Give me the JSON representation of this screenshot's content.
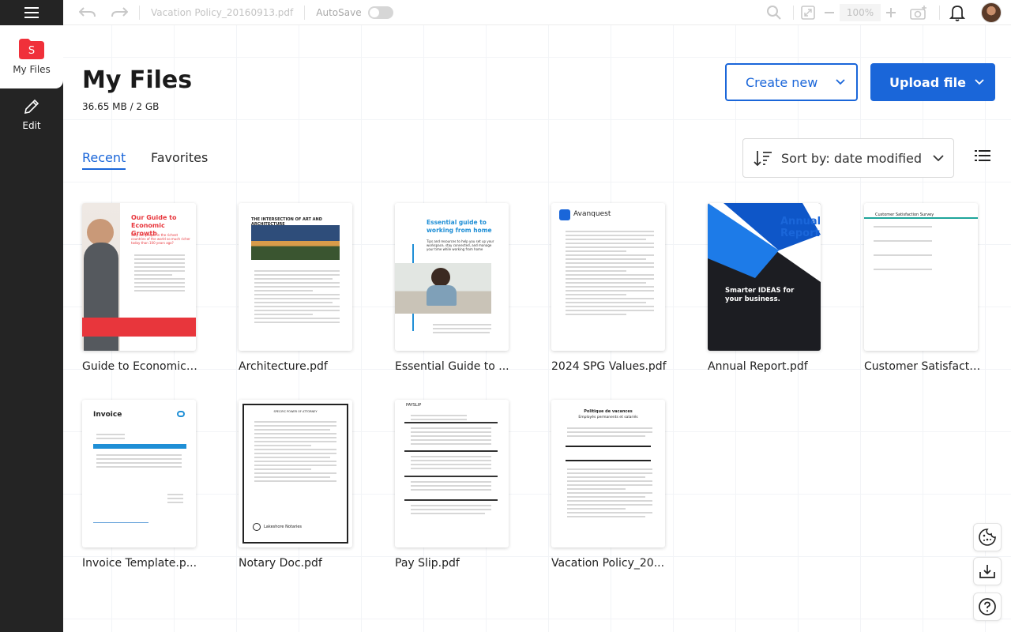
{
  "sidebar": {
    "my_files_label": "My Files",
    "edit_label": "Edit"
  },
  "toolbar": {
    "document_name": "Vacation Policy_20160913.pdf",
    "autosave_label": "AutoSave",
    "autosave_on": false,
    "zoom": "100%"
  },
  "page": {
    "title": "My Files",
    "storage": "36.65 MB / 2 GB",
    "create_new": "Create new",
    "upload_file": "Upload file"
  },
  "tabs": [
    {
      "label": "Recent",
      "active": true
    },
    {
      "label": "Favorites",
      "active": false
    }
  ],
  "sort": {
    "label": "Sort by: date modified"
  },
  "files": [
    {
      "name": "Guide to Economic Growth.pdf",
      "display": "Guide to Economic ...",
      "thumb_title": "Our Guide to Economic Growth",
      "thumb_subtitle": "Why are people in the richest countries of the world so much richer today than 100 years ago?"
    },
    {
      "name": "Architecture.pdf",
      "display": "Architecture.pdf",
      "thumb_title": "THE INTERSECTION OF ART AND ARCHITECTURE"
    },
    {
      "name": "Essential Guide to Working from Home.pdf",
      "display": "Essential Guide to ...",
      "thumb_title": "Essential guide to working from home",
      "thumb_subtitle": "Tips and resources to help you set up your workspace, stay connected, and manage your time while working from home"
    },
    {
      "name": "2024 SPG Values.pdf",
      "display": "2024 SPG Values.pdf",
      "thumb_title": "Avanquest"
    },
    {
      "name": "Annual Report.pdf",
      "display": "Annual Report.pdf",
      "thumb_title": "Annual Report",
      "thumb_subtitle": "Smarter IDEAS for your business."
    },
    {
      "name": "Customer Satisfaction Survey.pdf",
      "display": "Customer Satisfacti...",
      "thumb_title": "Customer Satisfaction Survey"
    },
    {
      "name": "Invoice Template.pdf",
      "display": "Invoice Template.p...",
      "thumb_title": "Invoice"
    },
    {
      "name": "Notary Doc.pdf",
      "display": "Notary Doc.pdf",
      "thumb_title": "SPECIFIC POWER OF ATTORNEY",
      "thumb_subtitle": "Lakeshore Notaries"
    },
    {
      "name": "Pay Slip.pdf",
      "display": "Pay Slip.pdf",
      "thumb_title": "PAYSLIP"
    },
    {
      "name": "Vacation Policy_20160913.pdf",
      "display": "Vacation Policy_20...",
      "thumb_title": "Politique de vacances",
      "thumb_subtitle": "Employés permanents et salariés"
    }
  ],
  "colors": {
    "accent": "#1a66d9",
    "brand_red": "#f0303a",
    "rail": "#242424"
  }
}
